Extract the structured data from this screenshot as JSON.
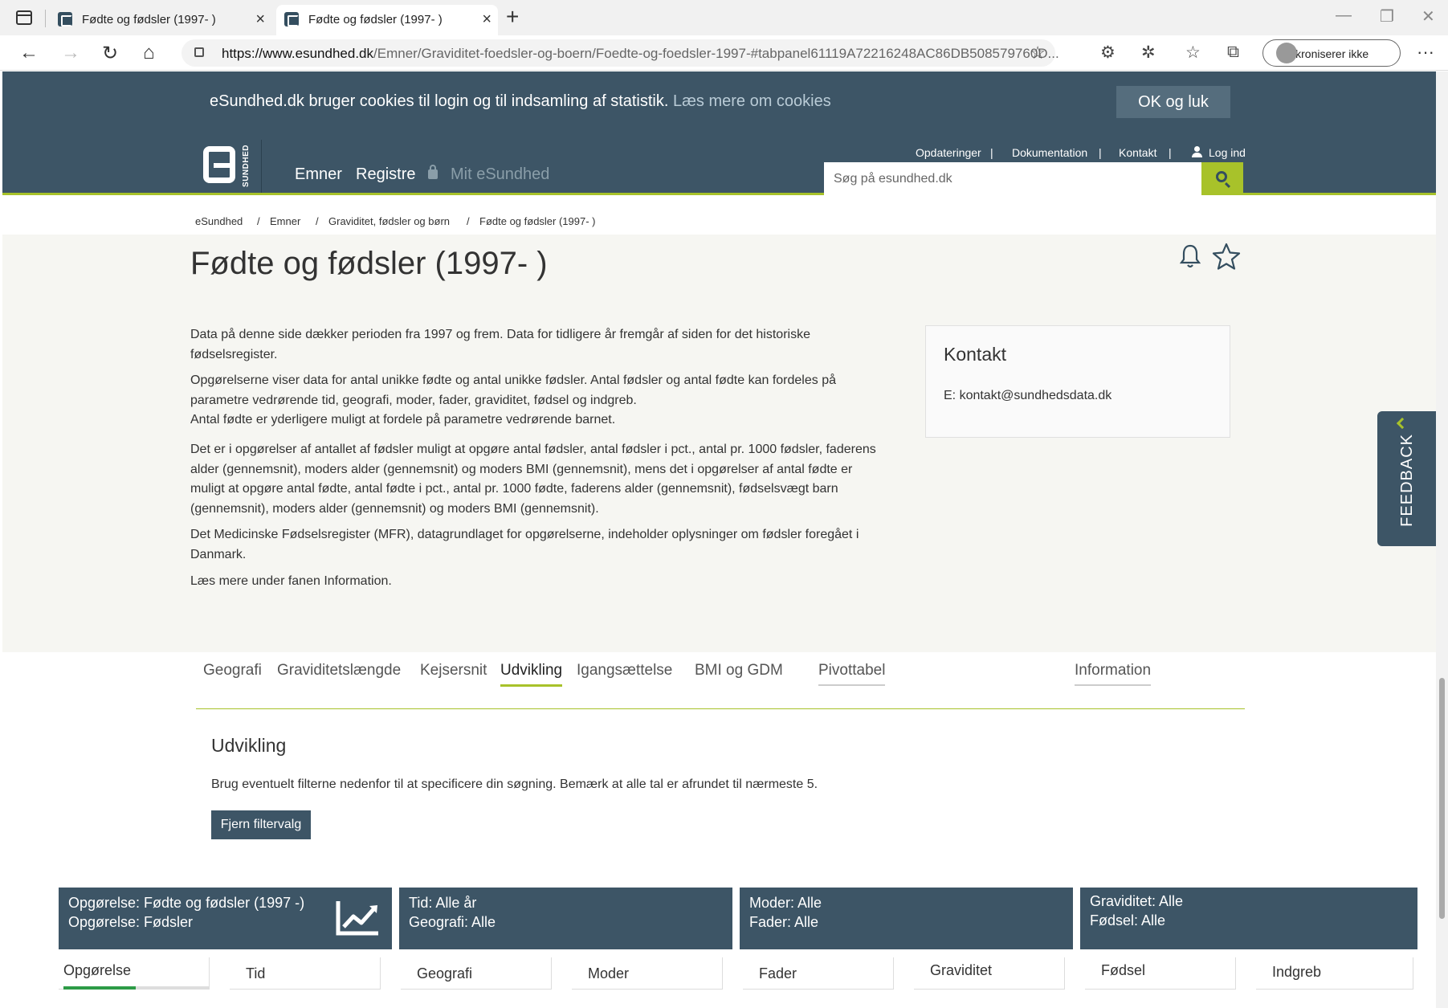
{
  "browser": {
    "tabs": [
      {
        "title": "Fødte og fødsler (1997- )"
      },
      {
        "title": "Fødte og fødsler (1997- )"
      }
    ],
    "url_host": "https://www.esundhed.dk",
    "url_path": "/Emner/Graviditet-foedsler-og-boern/Foedte-og-foedsler-1997-#tabpanel61119A72216248AC86DB508579760D...",
    "sync_label": "Synkroniserer ikke"
  },
  "cookie": {
    "message": "eSundhed.dk bruger cookies til login og til indsamling af statistik.",
    "link": "Læs mere om cookies",
    "button": "OK og luk"
  },
  "header": {
    "logo_text": "SUNDHED",
    "nav": [
      "Emner",
      "Registre",
      "Mit eSundhed"
    ],
    "toplinks": [
      "Opdateringer",
      "|",
      "Dokumentation",
      "|",
      "Kontakt",
      "|",
      "Log ind"
    ],
    "search_placeholder": "Søg på esundhed.dk"
  },
  "breadcrumb": [
    "eSundhed",
    "/",
    "Emner",
    "/",
    "Graviditet, fødsler og børn",
    "/",
    "Fødte og fødsler (1997- )"
  ],
  "page": {
    "title": "Fødte og fødsler (1997- )",
    "paragraphs": [
      "Data på denne side dækker perioden fra 1997 og frem. Data for tidligere år fremgår af siden for det historiske fødselsregister.",
      "Opgørelserne viser data for antal unikke fødte og antal unikke fødsler. Antal fødsler og antal fødte kan fordeles på parametre vedrørende tid, geografi, moder, fader, graviditet, fødsel og indgreb.",
      "Antal fødte er yderligere muligt at fordele på parametre vedrørende barnet.",
      "Det er i opgørelser af antallet af fødsler muligt at opgøre antal fødsler, antal fødsler i pct., antal pr. 1000 fødsler, faderens alder (gennemsnit), moders alder (gennemsnit) og moders BMI (gennemsnit), mens det i opgørelser af antal fødte er muligt at opgøre antal fødte, antal fødte i pct., antal pr. 1000 fødte, faderens alder (gennemsnit), fødselsvægt barn (gennemsnit), moders alder (gennemsnit) og moders BMI (gennemsnit).",
      "Det Medicinske Fødselsregister (MFR), datagrundlaget for opgørelserne, indeholder oplysninger om fødsler foregået i Danmark.",
      "Læs mere under fanen Information."
    ]
  },
  "kontakt": {
    "title": "Kontakt",
    "email": "E: kontakt@sundhedsdata.dk"
  },
  "feedback": "FEEDBACK",
  "page_tabs": [
    "Geografi",
    "Graviditetslængde",
    "Kejsersnit",
    "Udvikling",
    "Igangsættelse",
    "BMI og GDM",
    "Pivottabel",
    "Information"
  ],
  "section": {
    "title": "Udvikling",
    "hint": "Brug eventuelt filterne nedenfor til at specificere din søgning. Bemærk at alle tal er afrundet til nærmeste 5.",
    "clear_button": "Fjern filtervalg"
  },
  "filter_summary": [
    [
      "Opgørelse: Fødte og fødsler (1997 -)",
      "Opgørelse: Fødsler"
    ],
    [
      "Tid: Alle år",
      "Geografi: Alle"
    ],
    [
      "Moder: Alle",
      "Fader: Alle"
    ],
    [
      "Graviditet: Alle",
      "Fødsel: Alle"
    ]
  ],
  "filter_tabs": [
    "Opgørelse",
    "Tid",
    "Geografi",
    "Moder",
    "Fader",
    "Graviditet",
    "Fødsel",
    "Indgreb"
  ],
  "colors": {
    "brand": "#3d5566",
    "accent": "#a8c22a",
    "progress": "#2d9b46"
  }
}
